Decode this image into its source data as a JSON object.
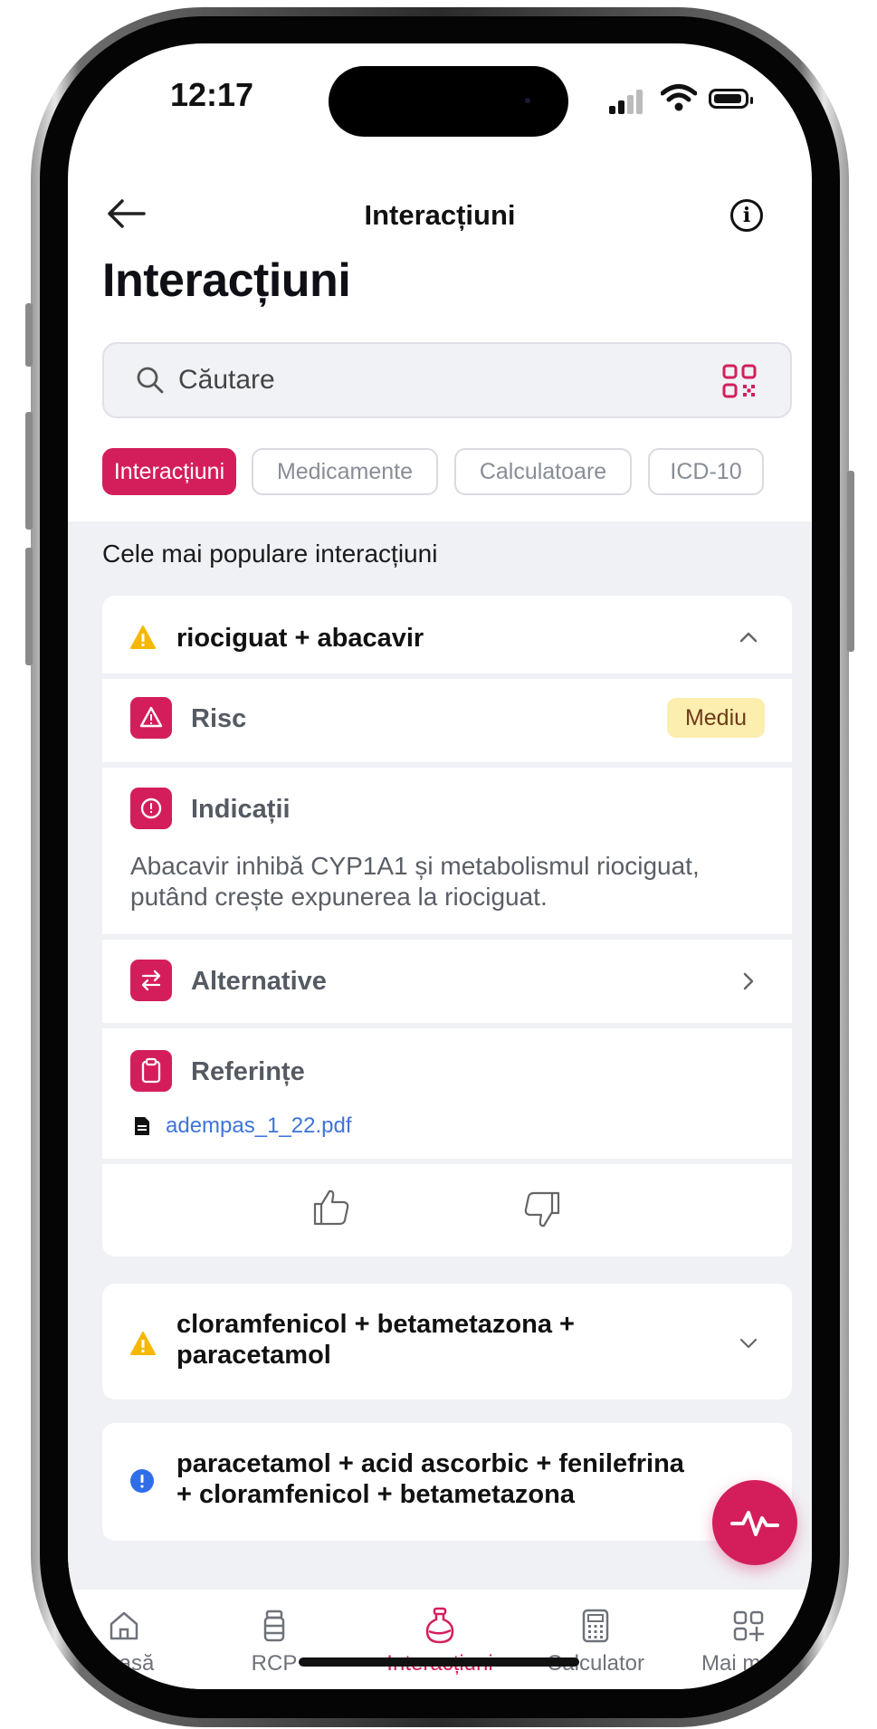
{
  "status_bar": {
    "time": "12:17"
  },
  "header": {
    "title": "Interacțiuni"
  },
  "page": {
    "title": "Interacțiuni"
  },
  "search": {
    "placeholder": "Căutare",
    "value": ""
  },
  "chips": [
    "Interacțiuni",
    "Medicamente",
    "Calculatoare",
    "ICD-10"
  ],
  "active_chip": "Interacțiuni",
  "section_label": "Cele mai populare interacțiuni",
  "expanded_card": {
    "title": "riociguat + abacavir",
    "risk_label": "Risc",
    "risk_level": "Mediu",
    "indications_label": "Indicații",
    "indications_text": "Abacavir inhibă CYP1A1 și metabolismul riociguat, putând crește expunerea la riociguat.",
    "alternatives_label": "Alternative",
    "references_label": "Referințe",
    "reference_file": "adempas_1_22.pdf"
  },
  "collapsed_cards": [
    {
      "title": "cloramfenicol + betametazona + paracetamol",
      "severity": "warning"
    },
    {
      "title": "paracetamol + acid ascorbic + fenilefrina + cloramfenicol + betametazona",
      "severity": "info"
    }
  ],
  "tab_bar": {
    "items": [
      "Acasă",
      "RCP",
      "Interacțiuni",
      "Calculator",
      "Mai multe"
    ],
    "active": "Interacțiuni"
  },
  "colors": {
    "accent": "#d41e5b",
    "warning": "#f5b800",
    "info": "#2f6ee6",
    "badge_bg": "#fbeeae",
    "link": "#3d74d9"
  }
}
